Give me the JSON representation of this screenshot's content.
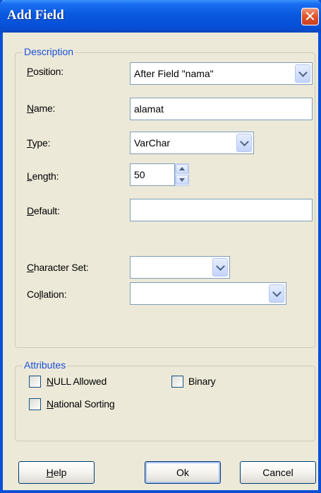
{
  "window": {
    "title": "Add Field",
    "close_symbol": "✕"
  },
  "description": {
    "legend": "Description",
    "position_label": "Position:",
    "position_value": "After Field \"nama\"",
    "name_label": "Name:",
    "name_value": "alamat",
    "type_label": "Type:",
    "type_value": "VarChar",
    "length_label": "Length:",
    "length_value": "50",
    "default_label": "Default:",
    "default_value": "",
    "charset_label": "Character Set:",
    "charset_value": "",
    "collation_label": "Collation:",
    "collation_value": ""
  },
  "attributes": {
    "legend": "Attributes",
    "null_allowed": {
      "label": "NULL Allowed",
      "checked": false
    },
    "binary": {
      "label": "Binary",
      "checked": false
    },
    "national_sorting": {
      "label": "National Sorting",
      "checked": false
    }
  },
  "buttons": {
    "help": "Help",
    "ok": "Ok",
    "cancel": "Cancel"
  }
}
